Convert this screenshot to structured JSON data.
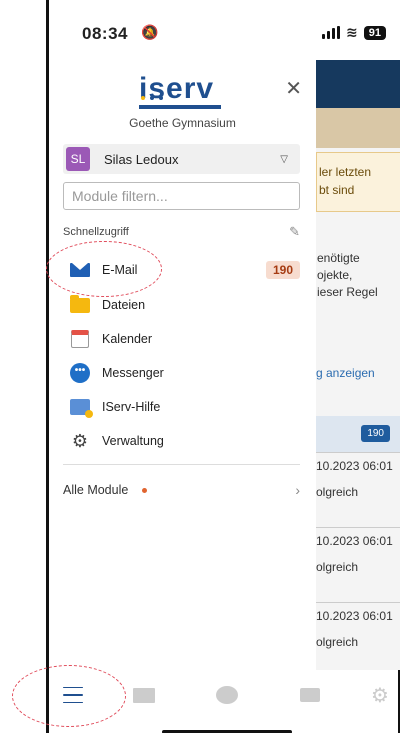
{
  "status_bar": {
    "time": "08:34",
    "battery": "91"
  },
  "drawer": {
    "logo_text": "iserv",
    "school": "Goethe Gymnasium",
    "user": {
      "initials": "SL",
      "name": "Silas Ledoux"
    },
    "filter_placeholder": "Module filtern...",
    "section_title": "Schnellzugriff",
    "items": [
      {
        "label": "E-Mail",
        "icon": "mail-icon",
        "count": "190"
      },
      {
        "label": "Dateien",
        "icon": "folder-icon"
      },
      {
        "label": "Kalender",
        "icon": "calendar-icon"
      },
      {
        "label": "Messenger",
        "icon": "messenger-icon"
      },
      {
        "label": "IServ-Hilfe",
        "icon": "help-icon"
      },
      {
        "label": "Verwaltung",
        "icon": "gear-icon"
      }
    ],
    "all_modules": "Alle Module"
  },
  "background": {
    "alert_line1": "ler letzten",
    "alert_line2": "bt sind",
    "text_line1": "enötigte",
    "text_line2": "ojekte,",
    "text_line3": "ieser Regel",
    "link": "g anzeigen",
    "badge": "190",
    "rows": [
      {
        "date": "10.2023 06:01",
        "subject": "olgreich"
      },
      {
        "date": "10.2023 06:01",
        "subject": "olgreich"
      },
      {
        "date": "10.2023 06:01",
        "subject": "olgreich"
      }
    ]
  },
  "colors": {
    "brand": "#1f4f8f",
    "count_bg": "#f7dccf",
    "count_text": "#a63c13",
    "annotation": "#e04b5a"
  }
}
